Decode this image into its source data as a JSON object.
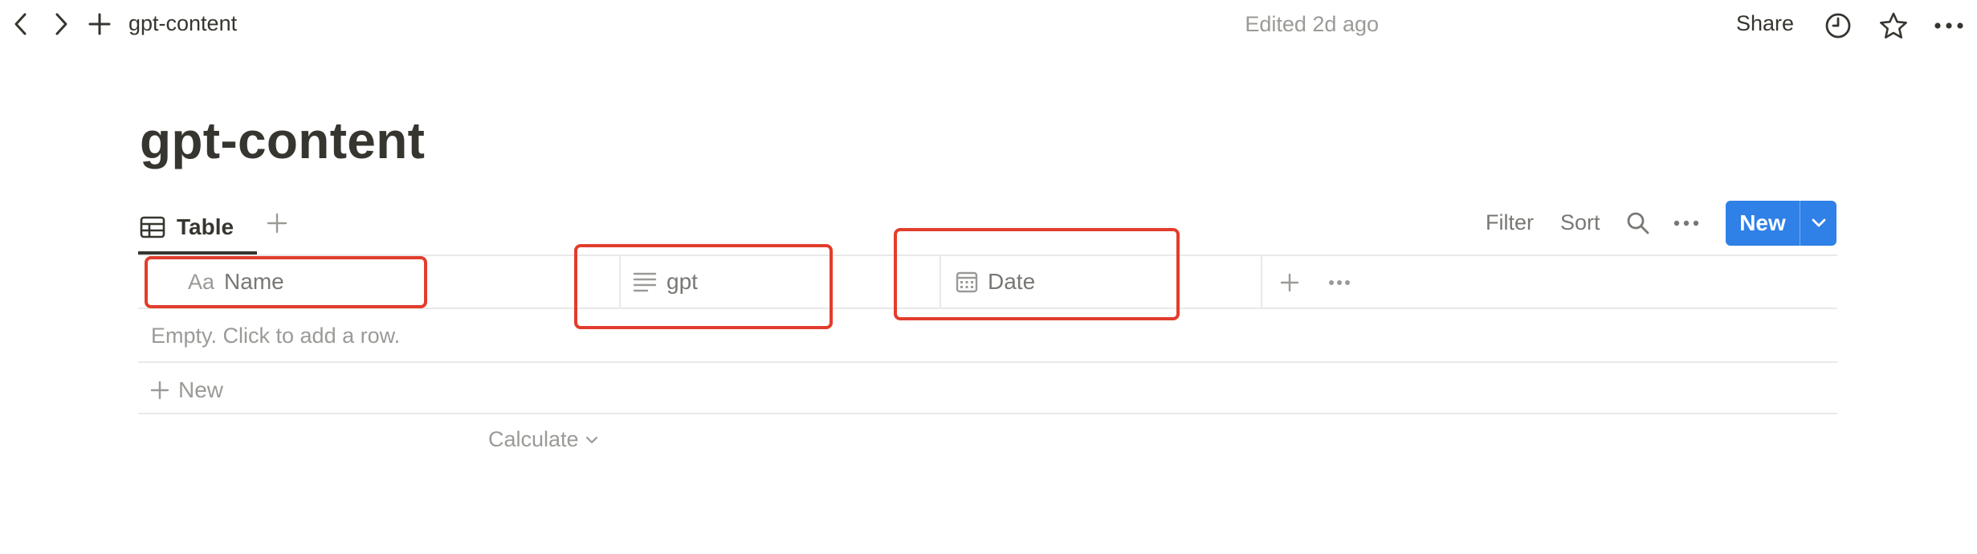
{
  "topbar": {
    "breadcrumb": "gpt-content",
    "edited": "Edited 2d ago",
    "share": "Share",
    "icons": [
      "back-arrow-icon",
      "forward-arrow-icon",
      "plus-icon",
      "clock-icon",
      "star-icon",
      "more-horizontal-icon"
    ]
  },
  "page": {
    "title": "gpt-content"
  },
  "views": {
    "active_tab": "Table",
    "add_view_icon": "plus-icon"
  },
  "toolbar": {
    "filter": "Filter",
    "sort": "Sort",
    "new": "New",
    "icons": [
      "search-icon",
      "more-horizontal-icon",
      "chevron-down-icon"
    ]
  },
  "table": {
    "columns": [
      {
        "label": "Name",
        "type_glyph": "Aa",
        "icon": "title-property-icon"
      },
      {
        "label": "gpt",
        "icon": "text-lines-icon"
      },
      {
        "label": "Date",
        "icon": "calendar-icon"
      }
    ],
    "add_column_icon": "plus-icon",
    "more_icon": "more-horizontal-icon",
    "empty_message": "Empty. Click to add a row.",
    "new_row": "New",
    "calculate": "Calculate"
  },
  "colors": {
    "accent": "#2f80e7",
    "text": "#37352f",
    "muted": "#787774",
    "placeholder": "#9b9a97",
    "divider": "#e9e9e7",
    "annotation": "#e23d2c"
  }
}
